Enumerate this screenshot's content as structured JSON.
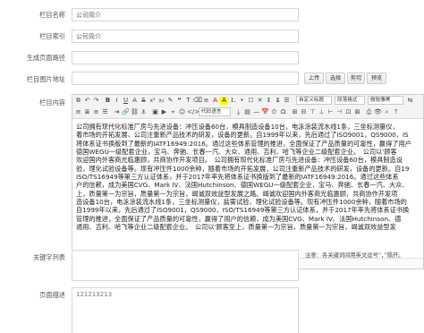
{
  "fields": {
    "column_name": {
      "label": "栏目名称",
      "value": "公司简介"
    },
    "column_index": {
      "label": "栏目索引",
      "value": "公司简介"
    },
    "generated_path": {
      "label": "生成页面路径",
      "value": ""
    },
    "column_image": {
      "label": "栏目图片地址",
      "value": ""
    },
    "column_content": {
      "label": "栏目内容"
    },
    "keywords": {
      "label": "关键字列表",
      "value": "",
      "note": "注意：各关键词间用英文逗号“，”隔开。"
    },
    "description": {
      "label": "页面描述",
      "value": "121213213"
    }
  },
  "image_buttons": {
    "upload": "上传",
    "choose": "选择",
    "crop": "剪切",
    "preview": "预览"
  },
  "toolbar": {
    "font_select": "微软雅黑",
    "size_select": "自定义标题",
    "code_language": "代码语言",
    "paragraph_select": "段落格式"
  },
  "content_lines": [
    "公司拥有现代化标准厂房与先进设备：冲压设备60台，模具制造设备10台，电泳涂装流水线1条，三坐标测量仪，",
    "着市场的开拓发展，公司注重新产品技术的研发，设备的更新。自1999年以来，先后通过了ISO9001，QS9000，IS",
    "将体系证书换版到了最新的IATF16949:2016。通过这些体系管理的推进，全面保证了产品质量的可靠性，赢得了用户",
    "德国WEGU一级配套企业，宝马、奔驰、长春一汽、大众、通用、吉利、哈飞等企业二级配套企业。　公司以'顾客",
    "欢迎国内外客商光临惠顾，共商协作开发项目。　公司拥有现代化标准厂房与先进设备：冲压设备60台，模具制造设",
    "验，理化试验设备等。现有冲压件1000余种，随着市场的开拓发展，公司注重新产品技术的研发，设备的更新。自19",
    "ISO/TS16949等第三方认证体系，并于2017年率先将体系证书换版到了最新的IATF16949:2016。通过这些体系",
    "户的信赖，成为美国CVG、Mark IV、法国Hutchinson、德国WEGU一级配套企业，宝马、奔驰、长春一汽、大众、",
    "上，质量第一为宗旨，质量第一为宗旨，竭诚双效益型发展之路。竭诚欢迎国内外客商光临惠顾，共商协作开发项",
    "造设备10台，电泳涂装流水线1条，三坐标测量仪，盐雾试验，理化试验设备等。现有冲压件1000余种，随着市场的",
    "自1999年以来，先后通过了ISO9001，QS9000，ISO/TS16949等第三方认证体系，并于2017年率先将体系证书换",
    "管理的推进，全面保证了产品质量的可靠性，赢得了用户的信赖，成为美国CVG、Mark IV、法国Hutchinson、德",
    "通用、吉利、哈飞等企业二级配套企业。　公司以'顾客至上，质量第一为宗旨，质量第一为宗旨，竭诚双效益型发"
  ],
  "element_path_label": "元素路径："
}
